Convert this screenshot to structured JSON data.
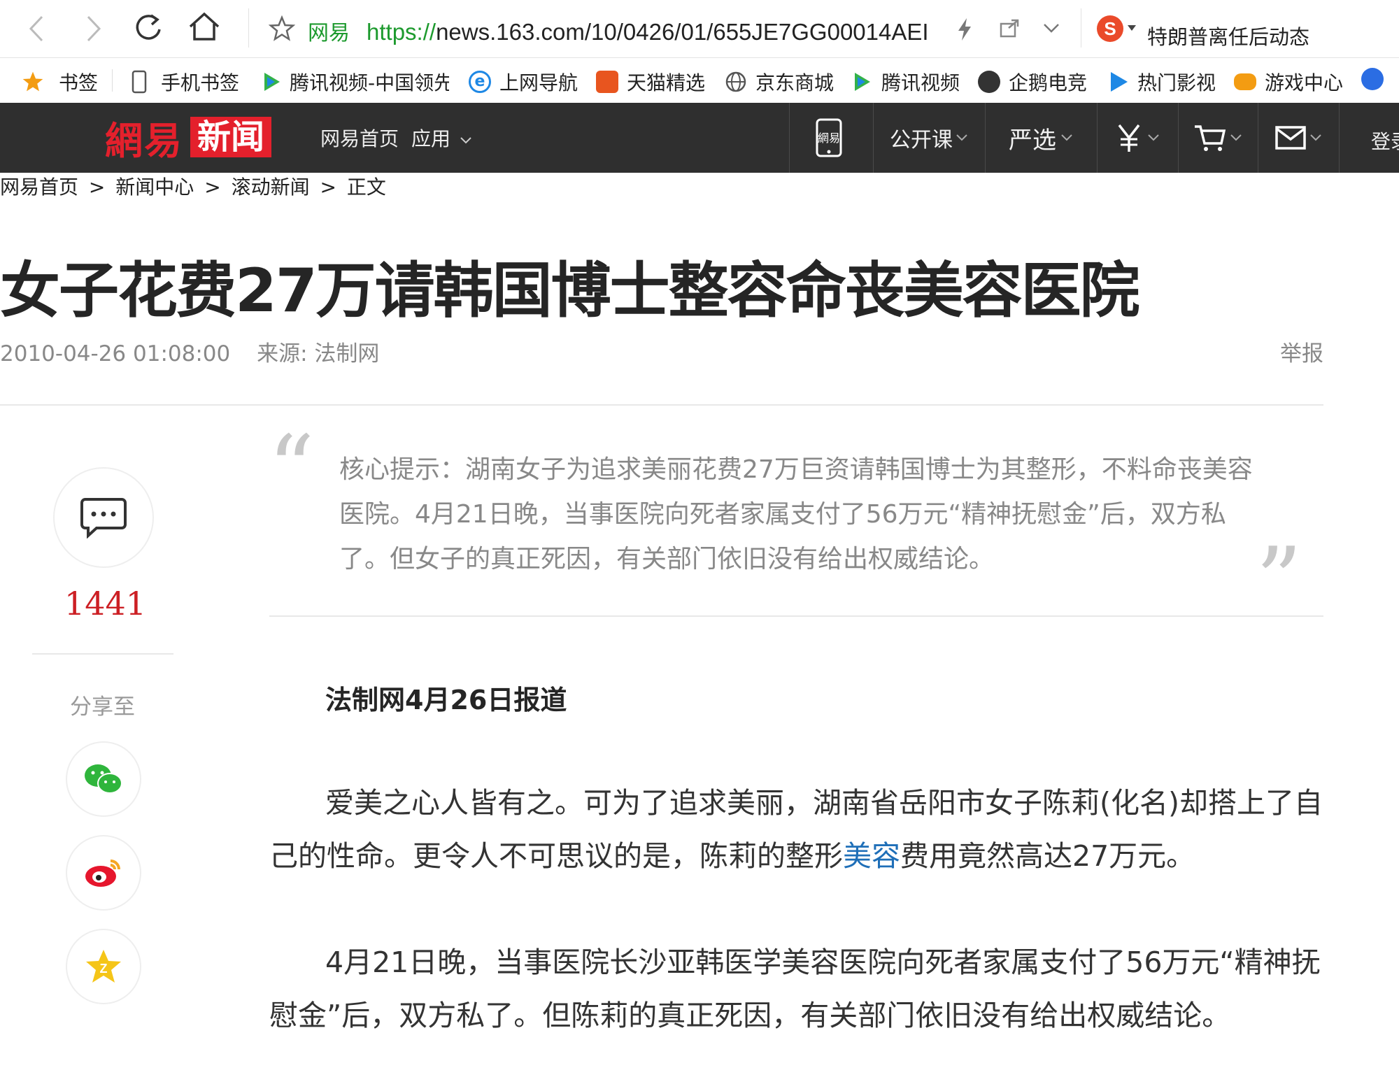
{
  "browser": {
    "address_site": "网易",
    "address_scheme": "https://",
    "address_rest": "news.163.com/10/0426/01/655JE7GG00014AEI",
    "search_text": "特朗普离任后动态"
  },
  "bookmarks": [
    {
      "label": "书签",
      "color": "#f39c12"
    },
    {
      "label": "手机书签",
      "color": "#666666"
    },
    {
      "label": "腾讯视频-中国领先",
      "color": "#33b24a"
    },
    {
      "label": "上网导航",
      "color": "#1e88e5"
    },
    {
      "label": "天猫精选",
      "color": "#e8551f"
    },
    {
      "label": "京东商城",
      "color": "#555555"
    },
    {
      "label": "腾讯视频",
      "color": "#33b24a"
    },
    {
      "label": "企鹅电竞",
      "color": "#333333"
    },
    {
      "label": "热门影视",
      "color": "#1e88e5"
    },
    {
      "label": "游戏中心",
      "color": "#f39c12"
    }
  ],
  "site_nav": {
    "logo_part1": "網易",
    "logo_part2": "新闻",
    "links": [
      "网易首页",
      "应用"
    ],
    "right_items": [
      "公开课",
      "严选"
    ],
    "login": "登录"
  },
  "breadcrumb": {
    "items": [
      "网易首页",
      ">",
      "新闻中心",
      ">",
      "滚动新闻",
      ">",
      "正文"
    ]
  },
  "article": {
    "title": "女子花费27万请韩国博士整容命丧美容医院",
    "timestamp": "2010-04-26 01:08:00",
    "source": "来源: 法制网",
    "report": "举报",
    "summary": "核心提示：湖南女子为追求美丽花费27万巨资请韩国博士为其整形，不料命丧美容医院。4月21日晚，当事医院向死者家属支付了56万元“精神抚慰金”后，双方私了。但女子的真正死因，有关部门依旧没有给出权威结论。",
    "dateline": "法制网4月26日报道",
    "p1_before": "爱美之心人皆有之。可为了追求美丽，湖南省岳阳市女子陈莉(化名)却搭上了自己的性命。更令人不可思议的是，陈莉的整形",
    "p1_link": "美容",
    "p1_after": "费用竟然高达27万元。",
    "p2": "4月21日晚，当事医院长沙亚韩医学美容医院向死者家属支付了56万元“精神抚慰金”后，双方私了。但陈莉的真正死因，有关部门依旧没有给出权威结论。"
  },
  "sidebar": {
    "comment_count": "1441",
    "share_label": "分享至"
  },
  "colors": {
    "brand_red": "#e4202c",
    "nav_bg": "#2f2f2f",
    "link_blue": "#1f6fb8",
    "count_red": "#cc1f24"
  },
  "icons": [
    "back-icon",
    "forward-icon",
    "reload-icon",
    "home-icon",
    "star-icon",
    "lightning-icon",
    "share-icon",
    "chevron-down-icon",
    "sogou-icon",
    "phone-app-icon",
    "yen-icon",
    "cart-icon",
    "mail-icon",
    "comment-icon",
    "wechat-icon",
    "weibo-icon",
    "qzone-icon"
  ]
}
